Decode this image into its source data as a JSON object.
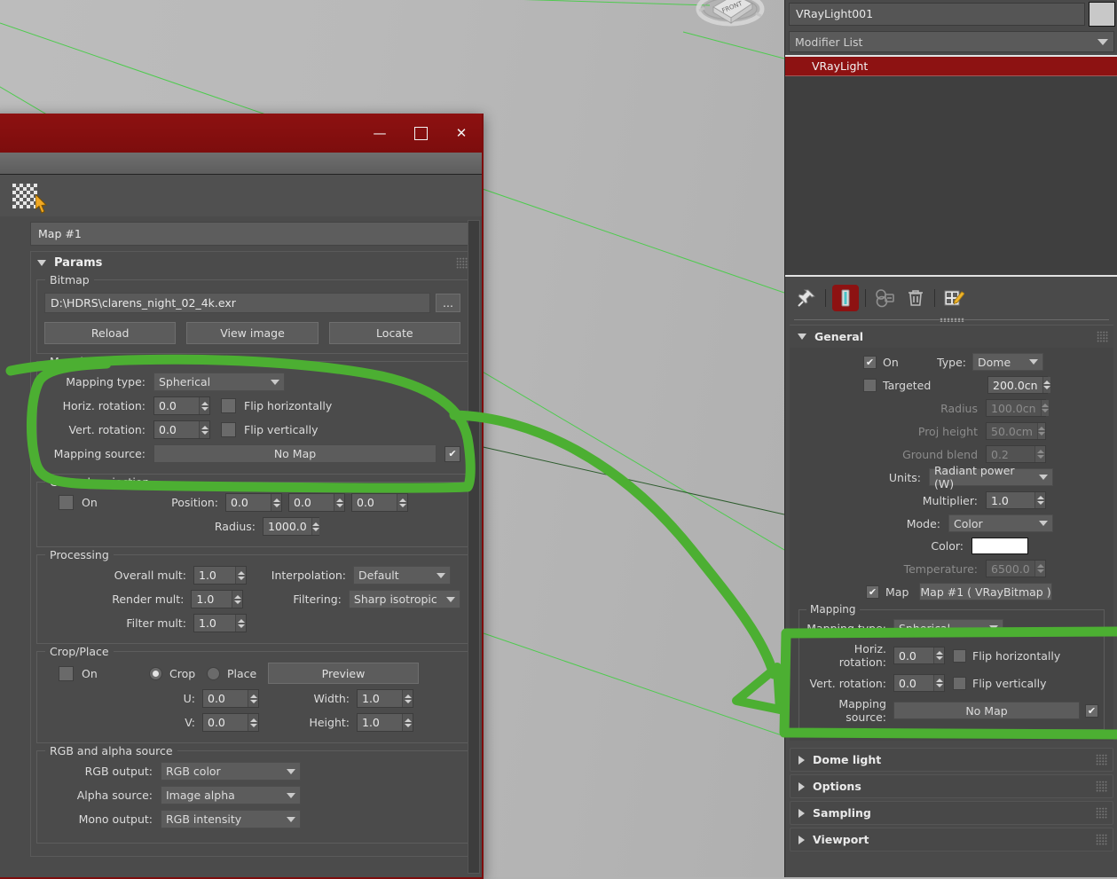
{
  "dialog": {
    "title_buttons": {
      "minimize": "—",
      "maximize": "❑",
      "close": "✕"
    },
    "map_name": "Map #1",
    "params_label": "Params",
    "bitmap": {
      "group_title": "Bitmap",
      "path": "D:\\HDRS\\clarens_night_02_4k.exr",
      "browse_label": "...",
      "reload_label": "Reload",
      "view_image_label": "View image",
      "locate_label": "Locate"
    },
    "mapping": {
      "group_title": "Mapping",
      "mapping_type_label": "Mapping type:",
      "mapping_type_value": "Spherical",
      "horiz_rotation_label": "Horiz. rotation:",
      "horiz_rotation_value": "0.0",
      "flip_h_label": "Flip horizontally",
      "vert_rotation_label": "Vert. rotation:",
      "vert_rotation_value": "0.0",
      "flip_v_label": "Flip vertically",
      "mapping_source_label": "Mapping source:",
      "mapping_source_value": "No Map"
    },
    "ground_projection": {
      "group_title": "Ground projection",
      "on_label": "On",
      "position_label": "Position:",
      "position_x": "0.0",
      "position_y": "0.0",
      "position_z": "0.0",
      "radius_label": "Radius:",
      "radius_value": "1000.0"
    },
    "processing": {
      "group_title": "Processing",
      "overall_mult_label": "Overall mult:",
      "overall_mult_value": "1.0",
      "render_mult_label": "Render mult:",
      "render_mult_value": "1.0",
      "filter_mult_label": "Filter mult:",
      "filter_mult_value": "1.0",
      "interpolation_label": "Interpolation:",
      "interpolation_value": "Default",
      "filtering_label": "Filtering:",
      "filtering_value": "Sharp isotropic"
    },
    "crop_place": {
      "group_title": "Crop/Place",
      "on_label": "On",
      "crop_label": "Crop",
      "place_label": "Place",
      "preview_label": "Preview",
      "u_label": "U:",
      "u_value": "0.0",
      "v_label": "V:",
      "v_value": "0.0",
      "width_label": "Width:",
      "width_value": "1.0",
      "height_label": "Height:",
      "height_value": "1.0"
    },
    "rgb_alpha": {
      "group_title": "RGB and alpha source",
      "rgb_output_label": "RGB output:",
      "rgb_output_value": "RGB color",
      "alpha_source_label": "Alpha source:",
      "alpha_source_value": "Image alpha",
      "mono_output_label": "Mono output:",
      "mono_output_value": "RGB intensity"
    }
  },
  "command_panel": {
    "object_name": "VRayLight001",
    "modifier_list_label": "Modifier List",
    "stack_item": "VRayLight",
    "tools": [
      "pin-stack-icon",
      "show-end-result-icon",
      "make-unique-icon",
      "remove-modifier-icon",
      "configure-modifier-sets-icon"
    ],
    "general": {
      "title": "General",
      "on_label": "On",
      "type_label": "Type:",
      "type_value": "Dome",
      "targeted_label": "Targeted",
      "target_dist_value": "200.0cn",
      "radius_label": "Radius",
      "radius_value": "100.0cn",
      "proj_height_label": "Proj height",
      "proj_height_value": "50.0cm",
      "ground_blend_label": "Ground blend",
      "ground_blend_value": "0.2",
      "units_label": "Units:",
      "units_value": "Radiant power (W)",
      "multiplier_label": "Multiplier:",
      "multiplier_value": "1.0",
      "mode_label": "Mode:",
      "mode_value": "Color",
      "color_label": "Color:",
      "color_value": "#ffffff",
      "temperature_label": "Temperature:",
      "temperature_value": "6500.0",
      "map_label": "Map",
      "map_value": "Map #1  ( VRayBitmap )"
    },
    "mapping": {
      "group_title": "Mapping",
      "mapping_type_label": "Mapping type:",
      "mapping_type_value": "Spherical",
      "horiz_rotation_label": "Horiz. rotation:",
      "horiz_rotation_value": "0.0",
      "flip_h_label": "Flip horizontally",
      "vert_rotation_label": "Vert. rotation:",
      "vert_rotation_value": "0.0",
      "flip_v_label": "Flip vertically",
      "mapping_source_label": "Mapping source:",
      "mapping_source_value": "No Map"
    },
    "rollouts": [
      {
        "label": "Dome light"
      },
      {
        "label": "Options"
      },
      {
        "label": "Sampling"
      },
      {
        "label": "Viewport"
      }
    ]
  },
  "viewport": {
    "viewcube_label": "FRONT"
  },
  "annotation": {
    "color": "#4caf32",
    "description": "green-highlight-and-arrow"
  }
}
